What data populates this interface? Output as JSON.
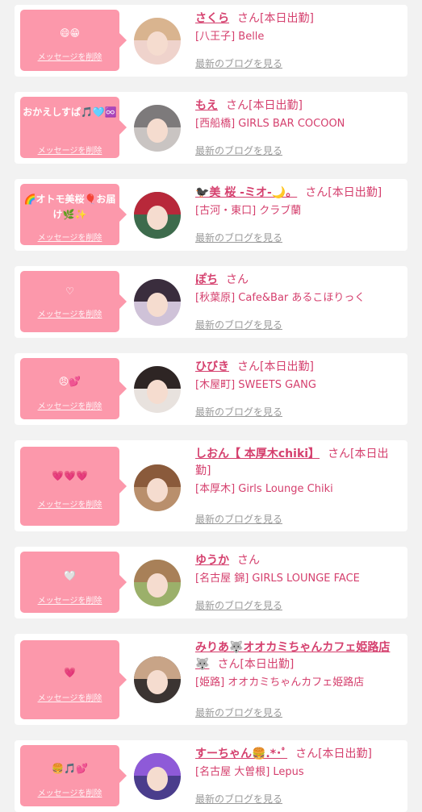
{
  "delete_label": "メッセージを削除",
  "blog_label": "最新のブログを見る",
  "colors": {
    "accent": "#d5406e",
    "bubble": "#fc98ab",
    "card": "#ffffff",
    "background": "#f2f2f2"
  },
  "items": [
    {
      "message": "😄😁",
      "name": "さくら",
      "suffix": "さん[本日出勤]",
      "shop": "[八王子] Belle"
    },
    {
      "message": "おかえしすぱ🎵🩵♾️",
      "name": "もえ",
      "suffix": "さん[本日出勤]",
      "shop": "[西船橋] GIRLS BAR COCOON"
    },
    {
      "message": "🌈オトモ美桜🎈お届け🌿✨",
      "name": "🐦‍⬛美 桜 -ミオ-🌙。",
      "suffix": "さん[本日出勤]",
      "shop": "[古河・東口] クラブ蘭"
    },
    {
      "message": "♡",
      "name": "ぽち",
      "suffix": "さん",
      "shop": "[秋葉原] Cafe&Bar あるこほりっく"
    },
    {
      "message": "😠💕",
      "name": "ひびき",
      "suffix": "さん[本日出勤]",
      "shop": "[木屋町] SWEETS GANG"
    },
    {
      "message": "💗💗💗",
      "name": "しおん【 本厚木chiki】",
      "suffix": "さん[本日出勤]",
      "shop": "[本厚木] Girls Lounge Chiki"
    },
    {
      "message": "🤍",
      "name": "ゆうか",
      "suffix": "さん",
      "shop": "[名古屋 錦] GIRLS LOUNGE FACE"
    },
    {
      "message": "💗",
      "name": "みりあ🐺オオカミちゃんカフェ姫路店🐺",
      "suffix": "さん[本日出勤]",
      "shop": "[姫路] オオカミちゃんカフェ姫路店"
    },
    {
      "message": "🍔🎵💕",
      "name": "すーちゃん🍔.*･ﾟ",
      "suffix": "さん[本日出勤]",
      "shop": "[名古屋 大曽根] Lepus"
    }
  ]
}
